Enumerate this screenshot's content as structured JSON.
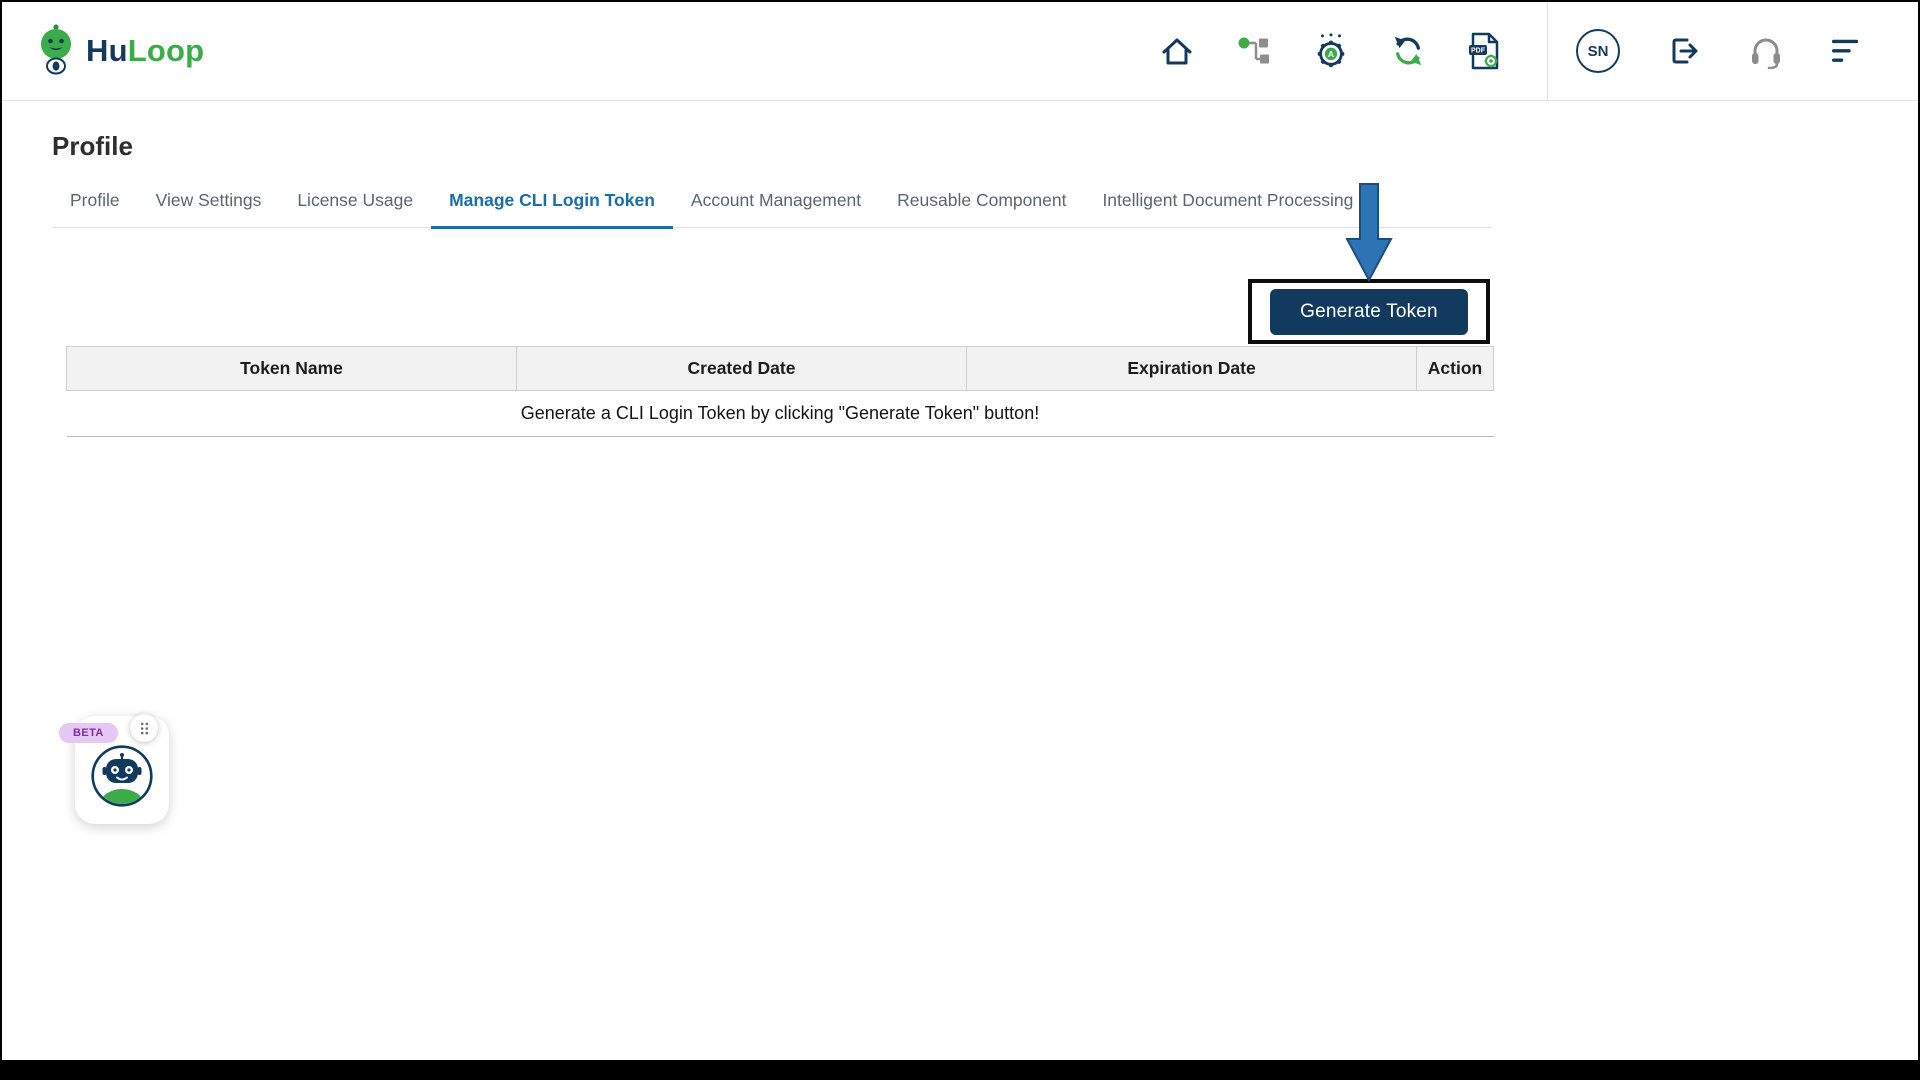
{
  "colors": {
    "navy": "#14395E",
    "green": "#3BAC49",
    "gray_icon": "#8C8C8C",
    "tab_active": "#1B6CA8",
    "arrow_fill": "#2E74B5",
    "arrow_stroke": "#1F4E79",
    "button_bg": "#123A5E"
  },
  "header": {
    "brand": {
      "hu": "Hu",
      "loop": "Loop"
    },
    "nav_icons": [
      {
        "name": "home-icon"
      },
      {
        "name": "workflow-icon"
      },
      {
        "name": "automation-gear-icon",
        "glyph": "A"
      },
      {
        "name": "sync-icon"
      },
      {
        "name": "pdf-settings-icon",
        "label": "PDF"
      }
    ],
    "avatar_initials": "SN"
  },
  "page": {
    "title": "Profile",
    "tabs": [
      {
        "label": "Profile",
        "active": false
      },
      {
        "label": "View Settings",
        "active": false
      },
      {
        "label": "License Usage",
        "active": false
      },
      {
        "label": "Manage CLI Login Token",
        "active": true
      },
      {
        "label": "Account Management",
        "active": false
      },
      {
        "label": "Reusable Component",
        "active": false
      },
      {
        "label": "Intelligent Document Processing",
        "active": false
      }
    ],
    "generate_token_label": "Generate Token",
    "table": {
      "headers": [
        "Token Name",
        "Created Date",
        "Expiration Date",
        "Action"
      ],
      "empty_message": "Generate a CLI Login Token by clicking \"Generate Token\" button!"
    }
  },
  "chat_widget": {
    "beta_label": "BETA"
  }
}
